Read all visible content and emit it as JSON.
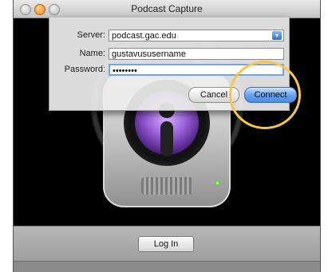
{
  "window": {
    "title": "Podcast Capture"
  },
  "login": {
    "server_label": "Server:",
    "server_value": "podcast.gac.edu",
    "name_label": "Name:",
    "name_value": "gustavususername",
    "password_label": "Password:",
    "password_value": "••••••••",
    "cancel_label": "Cancel",
    "connect_label": "Connect"
  },
  "main": {
    "login_button": "Log In"
  },
  "colors": {
    "highlight": "#f7c64a",
    "accent": "#4c8de4"
  },
  "icons": [
    "close-icon",
    "minimize-icon",
    "zoom-icon",
    "podcast-capture-app-icon",
    "dropdown-arrow-icon"
  ]
}
